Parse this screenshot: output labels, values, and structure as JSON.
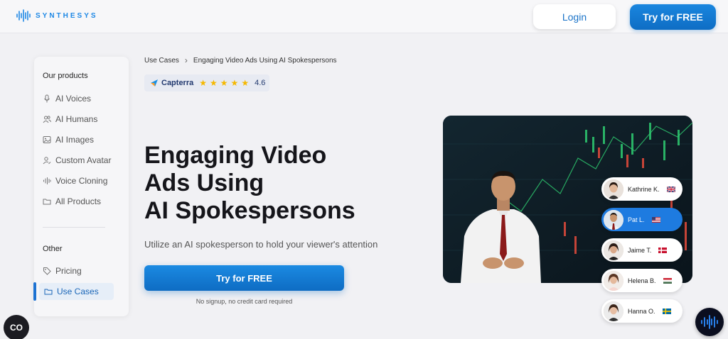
{
  "header": {
    "logo_text": "SYNTHESYS",
    "login_label": "Login",
    "try_label": "Try for FREE"
  },
  "sidebar": {
    "products_heading": "Our products",
    "products": [
      {
        "label": "AI Voices",
        "icon": "microphone-icon"
      },
      {
        "label": "AI Humans",
        "icon": "users-icon"
      },
      {
        "label": "AI Images",
        "icon": "image-icon"
      },
      {
        "label": "Custom Avatar",
        "icon": "user-edit-icon"
      },
      {
        "label": "Voice Cloning",
        "icon": "waveform-icon"
      },
      {
        "label": "All Products",
        "icon": "folder-icon"
      }
    ],
    "other_heading": "Other",
    "other": [
      {
        "label": "Pricing",
        "icon": "tag-icon"
      },
      {
        "label": "Use Cases",
        "icon": "folder-icon",
        "active": true
      }
    ]
  },
  "breadcrumb": {
    "parent": "Use Cases",
    "current": "Engaging Video Ads Using AI Spokespersons"
  },
  "capterra": {
    "brand": "Capterra",
    "stars": 5,
    "rating": "4.6"
  },
  "hero": {
    "title_line1": "Engaging Video",
    "title_line2": "Ads Using",
    "title_line3": "AI Spokespersons",
    "subtitle": "Utilize an AI spokesperson to hold your viewer's attention",
    "cta_label": "Try for FREE",
    "note": "No signup, no credit card required"
  },
  "avatars": [
    {
      "name": "Kathrine K.",
      "flag": "uk"
    },
    {
      "name": "Pat L.",
      "flag": "us",
      "selected": true
    },
    {
      "name": "Jaime T.",
      "flag": "dk"
    },
    {
      "name": "Helena B.",
      "flag": "hu"
    },
    {
      "name": "Hanna O.",
      "flag": "se"
    }
  ],
  "widgets": {
    "cookie_label": "CO"
  },
  "colors": {
    "accent": "#1a7fd8",
    "dark": "#15151a"
  }
}
